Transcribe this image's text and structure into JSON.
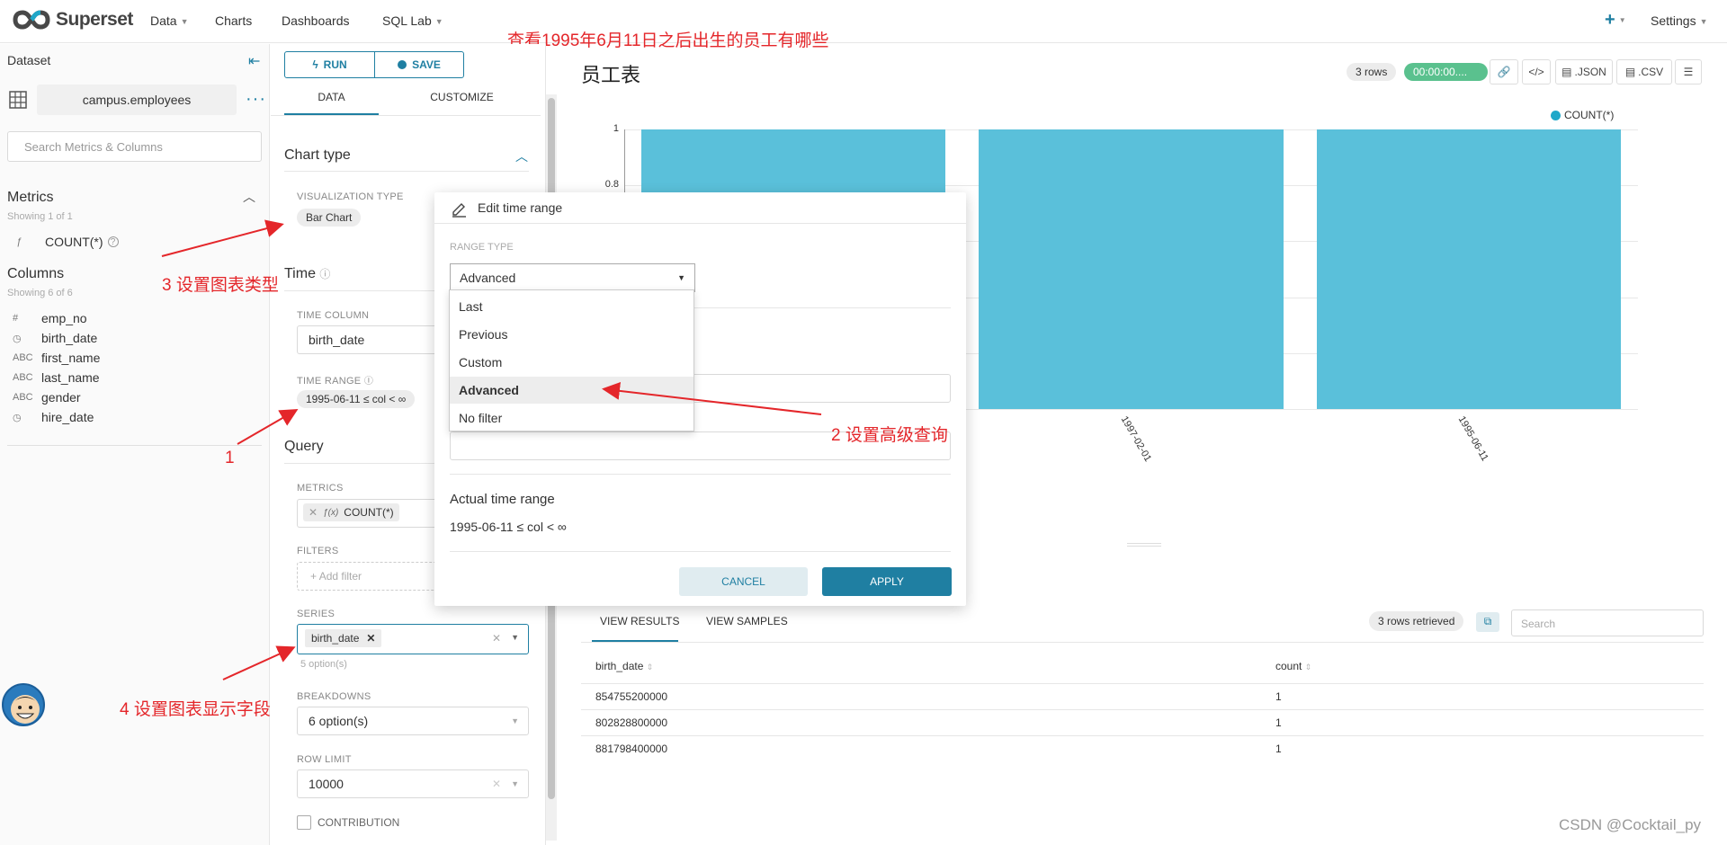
{
  "nav": {
    "brand": "Superset",
    "items": [
      "Data",
      "Charts",
      "Dashboards",
      "SQL Lab"
    ],
    "plus": "+",
    "settings": "Settings"
  },
  "top_annotation": "查看1995年6月11日之后出生的员工有哪些",
  "dataset_panel": {
    "header": "Dataset",
    "name": "campus.employees",
    "search_placeholder": "Search Metrics & Columns",
    "metrics_title": "Metrics",
    "metrics_showing": "Showing 1 of 1",
    "metrics": [
      {
        "type": "ƒ",
        "name": "COUNT(*)"
      }
    ],
    "columns_title": "Columns",
    "columns_showing": "Showing 6 of 6",
    "columns": [
      {
        "type": "#",
        "name": "emp_no"
      },
      {
        "type": "◷",
        "name": "birth_date"
      },
      {
        "type": "ABC",
        "name": "first_name"
      },
      {
        "type": "ABC",
        "name": "last_name"
      },
      {
        "type": "ABC",
        "name": "gender"
      },
      {
        "type": "◷",
        "name": "hire_date"
      }
    ]
  },
  "controls": {
    "run": "RUN",
    "save": "SAVE",
    "tab_data": "DATA",
    "tab_customize": "CUSTOMIZE",
    "chart_type_title": "Chart type",
    "viz_type_label": "VISUALIZATION TYPE",
    "viz_type_value": "Bar Chart",
    "time_title": "Time",
    "time_column_label": "TIME COLUMN",
    "time_column_value": "birth_date",
    "time_range_label": "TIME RANGE",
    "time_range_value": "1995-06-11 ≤ col < ∞",
    "query_title": "Query",
    "metrics_label": "METRICS",
    "metrics_value": "COUNT(*)",
    "filters_label": "FILTERS",
    "add_filter": "Add filter",
    "series_label": "SERIES",
    "series_value": "birth_date",
    "series_hint": "5 option(s)",
    "breakdowns_label": "BREAKDOWNS",
    "breakdowns_value": "6 option(s)",
    "row_limit_label": "ROW LIMIT",
    "row_limit_value": "10000",
    "contribution_label": "CONTRIBUTION"
  },
  "chart": {
    "title": "员工表",
    "rows_badge": "3 rows",
    "timer": "00:00:00....",
    "json": ".JSON",
    "csv": ".CSV",
    "legend": "COUNT(*)",
    "legend_color": "#1fa8c9",
    "bar_color": "#5ac0da"
  },
  "chart_data": {
    "type": "bar",
    "categories": [
      "",
      "1997-02-01",
      "1995-06-11"
    ],
    "values": [
      1,
      1,
      1
    ],
    "series": [
      {
        "name": "COUNT(*)",
        "values": [
          1,
          1,
          1
        ]
      }
    ],
    "ylim": [
      0,
      1
    ],
    "yticks": [
      "1",
      "0.8"
    ],
    "grid": true,
    "legend_position": "top-right"
  },
  "modal": {
    "title": "Edit time range",
    "range_type_label": "RANGE TYPE",
    "range_type_value": "Advanced",
    "options": [
      "Last",
      "Previous",
      "Custom",
      "Advanced",
      "No filter"
    ],
    "selected_option": "Advanced",
    "actual_label": "Actual time range",
    "actual_value": "1995-06-11 ≤ col < ∞",
    "cancel": "CANCEL",
    "apply": "APPLY"
  },
  "results": {
    "tab_results": "VIEW RESULTS",
    "tab_samples": "VIEW SAMPLES",
    "retrieved": "3 rows retrieved",
    "search_placeholder": "Search",
    "columns": [
      "birth_date",
      "count"
    ],
    "rows": [
      [
        "854755200000",
        "1"
      ],
      [
        "802828800000",
        "1"
      ],
      [
        "881798400000",
        "1"
      ]
    ]
  },
  "annotations": {
    "a1": "1",
    "a2": "2 设置高级查询",
    "a3": "3 设置图表类型",
    "a4": "4 设置图表显示字段",
    "watermark": "CSDN @Cocktail_py"
  }
}
